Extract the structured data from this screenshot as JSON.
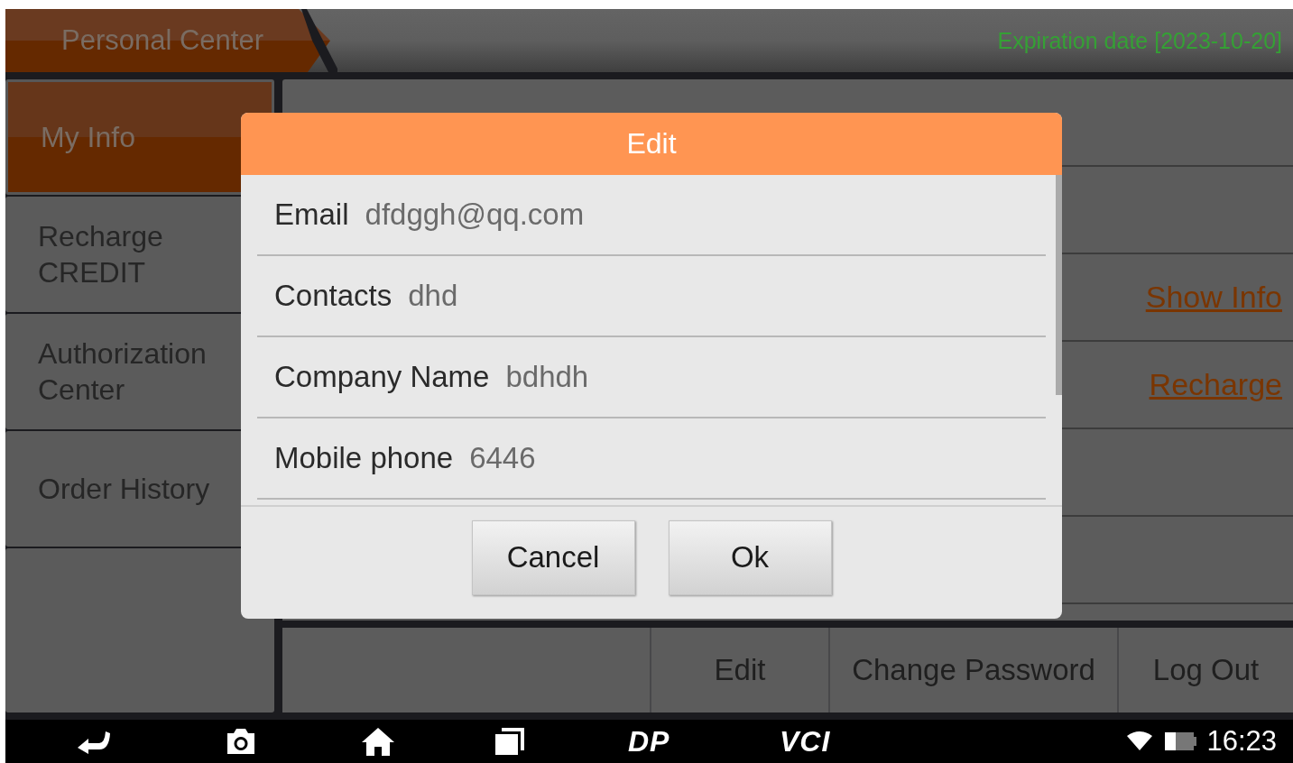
{
  "header": {
    "title": "Personal Center",
    "expiration": "Expiration date [2023-10-20]"
  },
  "sidebar": {
    "items": [
      {
        "label": "My Info",
        "selected": true
      },
      {
        "label": "Recharge CREDIT",
        "selected": false
      },
      {
        "label": "Authorization Center",
        "selected": false
      },
      {
        "label": "Order History",
        "selected": false
      }
    ]
  },
  "info_rows": [
    {
      "kind": "blank"
    },
    {
      "kind": "blank"
    },
    {
      "kind": "link",
      "link": "Show Info"
    },
    {
      "kind": "link",
      "link": "Recharge"
    },
    {
      "kind": "blank"
    },
    {
      "kind": "blank"
    }
  ],
  "actions": [
    "Edit",
    "Change Password",
    "Log Out"
  ],
  "dialog": {
    "title": "Edit",
    "fields": [
      {
        "label": "Email",
        "value": "dfdggh@qq.com"
      },
      {
        "label": "Contacts",
        "value": "dhd"
      },
      {
        "label": "Company Name",
        "value": "bdhdh"
      },
      {
        "label": "Mobile phone",
        "value": "6446"
      }
    ],
    "buttons": [
      "Cancel",
      "Ok"
    ]
  },
  "nav_bar": {
    "logos": [
      "DP",
      "VCI"
    ],
    "time": "16:23"
  }
}
